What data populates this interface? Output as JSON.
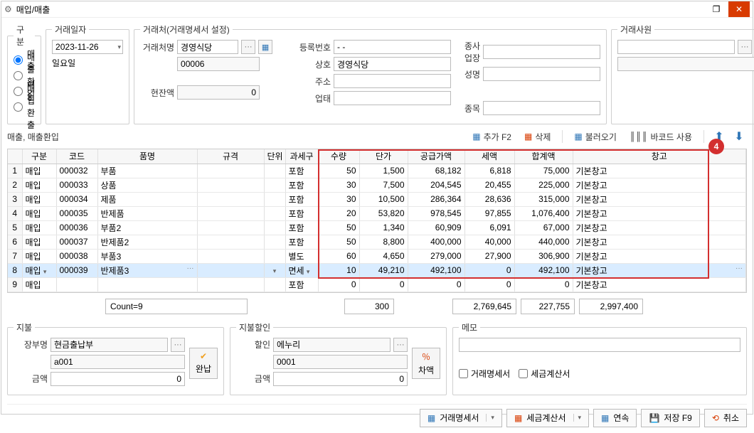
{
  "window": {
    "title": "매입/매출"
  },
  "gubun": {
    "legend": "구분",
    "options": [
      "매출",
      "매출환입",
      "매입",
      "매입환출"
    ],
    "selected": "매출"
  },
  "date": {
    "legend": "거래일자",
    "value": "2023-11-26",
    "dow": "일요일"
  },
  "partner": {
    "legend": "거래처(거래명세서 설정)",
    "name_label": "거래처명",
    "name": "경영식당",
    "code": "00006",
    "balance_label": "현잔액",
    "balance": "0",
    "regno_label": "등록번호",
    "regno": "- - ",
    "company_label": "상호",
    "company": "경영식당",
    "addr_label": "주소",
    "addr": "",
    "biz_label": "업태",
    "biz": "",
    "site_label": "종사업장",
    "site": "",
    "person_label": "성명",
    "person": "",
    "item_label": "종목",
    "item": ""
  },
  "emp": {
    "legend": "거래사원"
  },
  "section_label": "매출, 매출환입",
  "toolbar": {
    "add": "추가 F2",
    "del": "삭제",
    "load": "불러오기",
    "barcode": "바코드 사용"
  },
  "grid": {
    "headers": [
      "",
      "구분",
      "코드",
      "품명",
      "규격",
      "단위",
      "과세구",
      "수량",
      "단가",
      "공급가액",
      "세액",
      "합계액",
      "창고"
    ],
    "rows": [
      {
        "n": "1",
        "g": "매입",
        "code": "000032",
        "name": "부품",
        "spec": "",
        "unit": "",
        "tax": "포함",
        "qty": "50",
        "price": "1,500",
        "supply": "68,182",
        "vat": "6,818",
        "total": "75,000",
        "wh": "기본창고"
      },
      {
        "n": "2",
        "g": "매입",
        "code": "000033",
        "name": "상품",
        "spec": "",
        "unit": "",
        "tax": "포함",
        "qty": "30",
        "price": "7,500",
        "supply": "204,545",
        "vat": "20,455",
        "total": "225,000",
        "wh": "기본창고"
      },
      {
        "n": "3",
        "g": "매입",
        "code": "000034",
        "name": "제품",
        "spec": "",
        "unit": "",
        "tax": "포함",
        "qty": "30",
        "price": "10,500",
        "supply": "286,364",
        "vat": "28,636",
        "total": "315,000",
        "wh": "기본창고"
      },
      {
        "n": "4",
        "g": "매입",
        "code": "000035",
        "name": "반제품",
        "spec": "",
        "unit": "",
        "tax": "포함",
        "qty": "20",
        "price": "53,820",
        "supply": "978,545",
        "vat": "97,855",
        "total": "1,076,400",
        "wh": "기본창고"
      },
      {
        "n": "5",
        "g": "매입",
        "code": "000036",
        "name": "부품2",
        "spec": "",
        "unit": "",
        "tax": "포함",
        "qty": "50",
        "price": "1,340",
        "supply": "60,909",
        "vat": "6,091",
        "total": "67,000",
        "wh": "기본창고"
      },
      {
        "n": "6",
        "g": "매입",
        "code": "000037",
        "name": "반제품2",
        "spec": "",
        "unit": "",
        "tax": "포함",
        "qty": "50",
        "price": "8,800",
        "supply": "400,000",
        "vat": "40,000",
        "total": "440,000",
        "wh": "기본창고"
      },
      {
        "n": "7",
        "g": "매입",
        "code": "000038",
        "name": "부품3",
        "spec": "",
        "unit": "",
        "tax": "별도",
        "qty": "60",
        "price": "4,650",
        "supply": "279,000",
        "vat": "27,900",
        "total": "306,900",
        "wh": "기본창고"
      },
      {
        "n": "8",
        "g": "매입",
        "code": "000039",
        "name": "반제품3",
        "spec": "",
        "unit": "",
        "tax": "면세",
        "qty": "10",
        "price": "49,210",
        "supply": "492,100",
        "vat": "0",
        "total": "492,100",
        "wh": "기본창고",
        "sel": true
      },
      {
        "n": "9",
        "g": "매입",
        "code": "",
        "name": "",
        "spec": "",
        "unit": "",
        "tax": "포함",
        "qty": "0",
        "price": "0",
        "supply": "0",
        "vat": "0",
        "total": "0",
        "wh": "기본창고"
      }
    ]
  },
  "totals": {
    "count": "Count=9",
    "qty": "300",
    "supply": "2,769,645",
    "vat": "227,755",
    "total": "2,997,400"
  },
  "pay": {
    "legend": "지불",
    "book_label": "장부명",
    "book": "현금출납부",
    "book_code": "a001",
    "amt_label": "금액",
    "amt": "0",
    "btn": "완납"
  },
  "disc": {
    "legend": "지불할인",
    "type_label": "할인",
    "type": "에누리",
    "type_code": "0001",
    "amt_label": "금액",
    "amt": "0",
    "btn": "차액"
  },
  "memo": {
    "legend": "메모",
    "chk1": "거래명세서",
    "chk2": "세금계산서"
  },
  "footer": {
    "stmt": "거래명세서",
    "tax": "세금계산서",
    "cont": "연속",
    "save": "저장 F9",
    "cancel": "취소"
  },
  "badge": "4"
}
